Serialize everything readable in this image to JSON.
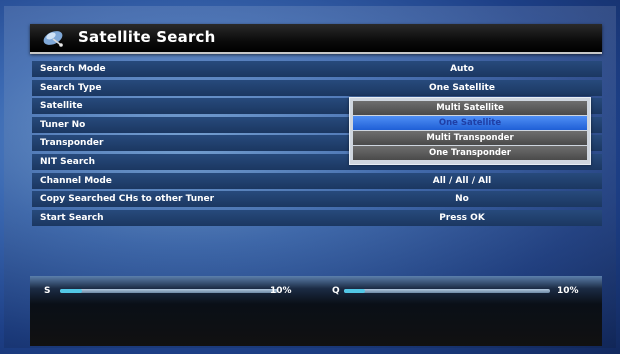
{
  "window": {
    "title": "Satellite Search",
    "title_icon": "satellite-dish-icon"
  },
  "menu": {
    "rows": [
      {
        "label": "Search Mode",
        "value": "Auto"
      },
      {
        "label": "Search Type",
        "value": "One Satellite"
      },
      {
        "label": "Satellite",
        "value": ""
      },
      {
        "label": "Tuner No",
        "value": ""
      },
      {
        "label": "Transponder",
        "value": ""
      },
      {
        "label": "NIT Search",
        "value": ""
      },
      {
        "label": "Channel Mode",
        "value": "All / All / All"
      },
      {
        "label": "Copy Searched CHs to other Tuner",
        "value": "No"
      },
      {
        "label": "Start Search",
        "value": "Press OK"
      }
    ]
  },
  "dropdown": {
    "options": [
      "Multi Satellite",
      "One Satellite",
      "Multi Transponder",
      "One Transponder"
    ],
    "selected_index": 1
  },
  "signal": {
    "strength": {
      "label": "S",
      "value_text": "10%",
      "level": 0.1
    },
    "quality": {
      "label": "Q",
      "value_text": "10%",
      "level": 0.1
    }
  },
  "colors": {
    "selected_highlight": "#1f5fd6",
    "meter_fill": "#52c7e6"
  }
}
